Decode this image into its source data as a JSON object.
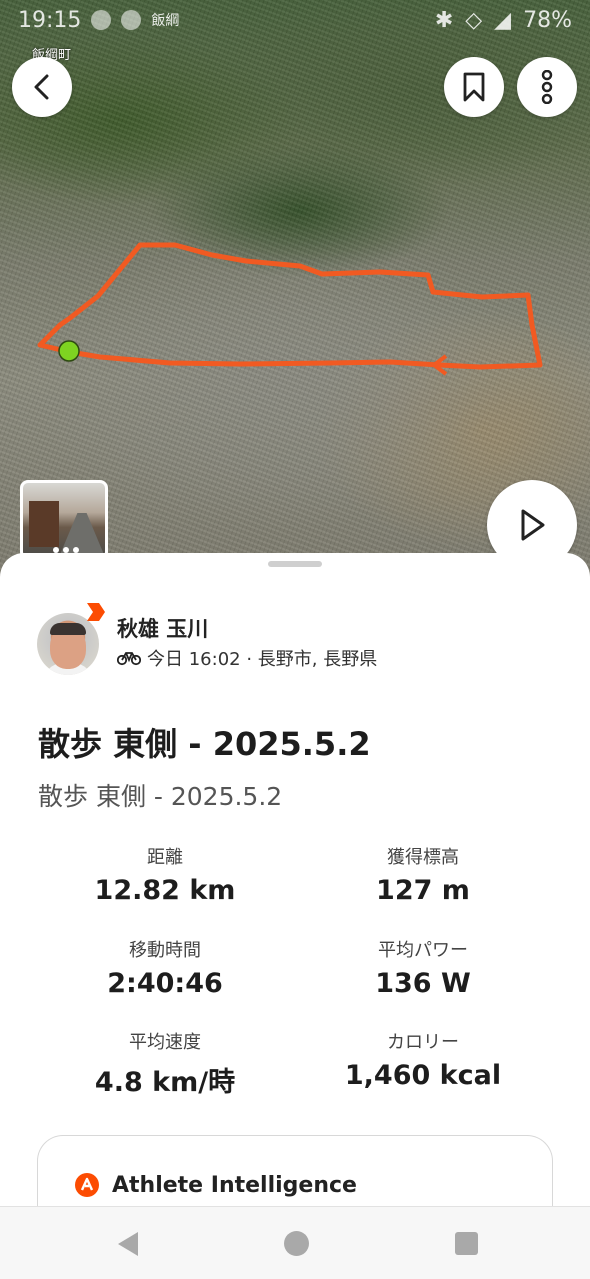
{
  "status_bar": {
    "time": "19:15",
    "battery": "78%",
    "carrier_label": "飯綱"
  },
  "map": {
    "place_label": "飯綱町",
    "route_color": "#f15a22",
    "start_marker_color": "#7ed321"
  },
  "athlete": {
    "name": "秋雄 玉川",
    "meta": "今日 16:02 · 長野市, 長野県",
    "activity_icon": "bike-icon"
  },
  "activity": {
    "title": "散歩 東側 - 2025.5.2",
    "subtitle": "散歩 東側 - 2025.5.2"
  },
  "stats": [
    {
      "label": "距離",
      "value": "12.82 km"
    },
    {
      "label": "獲得標高",
      "value": "127 m"
    },
    {
      "label": "移動時間",
      "value": "2:40:46"
    },
    {
      "label": "平均パワー",
      "value": "136 W"
    },
    {
      "label": "平均速度",
      "value": "4.8 km/時"
    },
    {
      "label": "カロリー",
      "value": "1,460 kcal"
    }
  ],
  "athlete_intelligence": {
    "title": "Athlete Intelligence"
  },
  "colors": {
    "brand": "#fc4c02",
    "text": "#1d1d1d"
  }
}
